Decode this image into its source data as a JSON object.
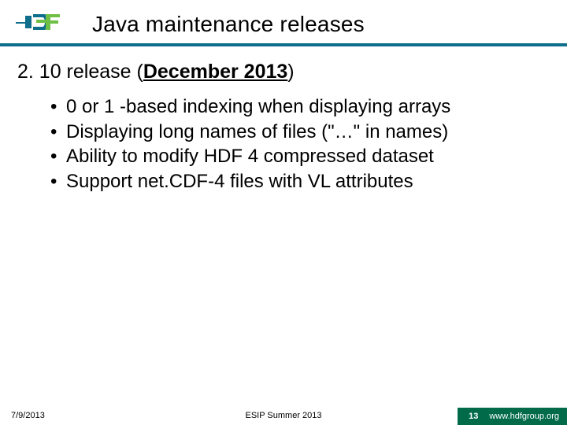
{
  "header": {
    "title": "Java maintenance releases"
  },
  "content": {
    "release_prefix": "2. 10 release (",
    "release_emph": "December 2013",
    "release_suffix": ")",
    "bullets": [
      "0 or 1 -based indexing when displaying arrays",
      "Displaying long names of files (\"…\" in names)",
      "Ability to modify HDF 4 compressed dataset",
      "Support net.CDF-4 files with VL attributes"
    ]
  },
  "footer": {
    "date": "7/9/2013",
    "center": "ESIP Summer 2013",
    "page": "13",
    "url": "www.hdfgroup.org"
  }
}
